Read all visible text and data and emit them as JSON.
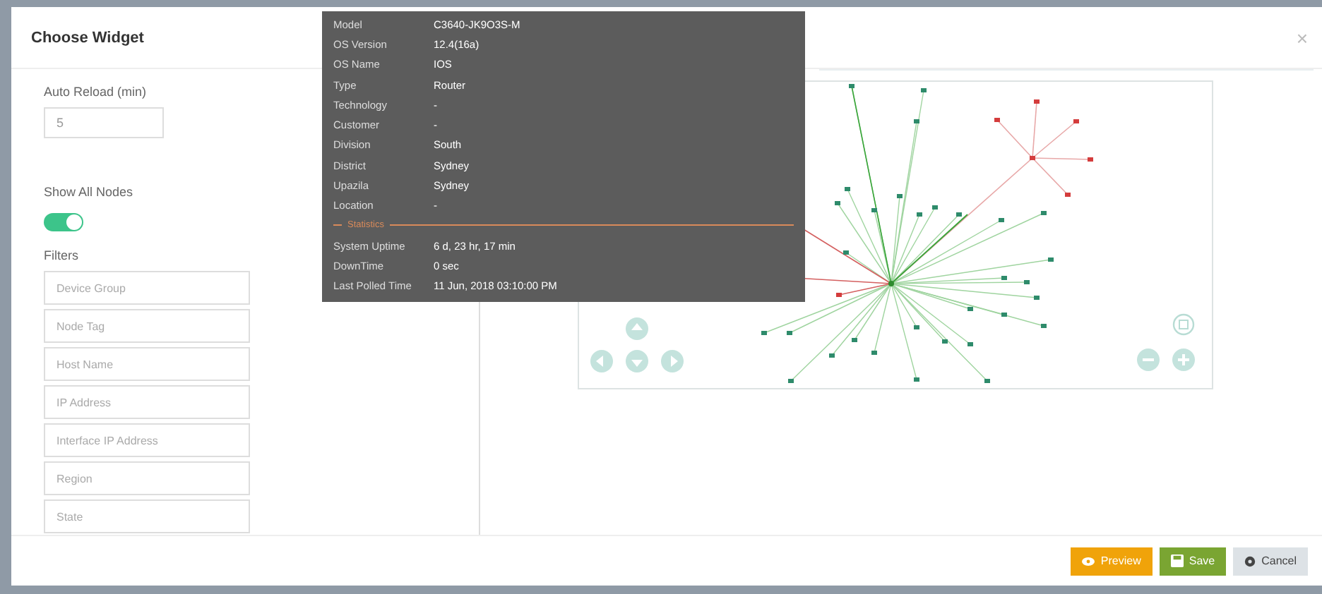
{
  "dialog": {
    "title": "Choose Widget",
    "close": "×"
  },
  "form": {
    "auto_reload": {
      "label": "Auto Reload (min)",
      "value": "5"
    },
    "show_all_nodes": {
      "label": "Show All Nodes",
      "on": true
    },
    "filters_label": "Filters",
    "filters": [
      {
        "placeholder": "Device Group"
      },
      {
        "placeholder": "Node Tag"
      },
      {
        "placeholder": "Host Name"
      },
      {
        "placeholder": "IP Address"
      },
      {
        "placeholder": "Interface IP Address"
      },
      {
        "placeholder": "Region"
      },
      {
        "placeholder": "State"
      }
    ]
  },
  "tooltip": {
    "rows": [
      {
        "label": "Model",
        "value": "C3640-JK9O3S-M"
      },
      {
        "label": "OS Version",
        "value": "12.4(16a)"
      },
      {
        "label": "OS Name",
        "value": "IOS"
      },
      {
        "label": "Type",
        "value": "Router"
      },
      {
        "label": "Technology",
        "value": "-"
      },
      {
        "label": "Customer",
        "value": "-"
      },
      {
        "label": "Division",
        "value": "South"
      },
      {
        "label": "District",
        "value": "Sydney"
      },
      {
        "label": "Upazila",
        "value": "Sydney"
      },
      {
        "label": "Location",
        "value": "-"
      }
    ],
    "section": "Statistics",
    "stats": [
      {
        "label": "System Uptime",
        "value": "6 d, 23 hr, 17 min"
      },
      {
        "label": "DownTime",
        "value": "0 sec"
      },
      {
        "label": "Last Polled Time",
        "value": "11 Jun, 2018  03:10:00 PM"
      }
    ]
  },
  "buttons": [
    {
      "kind": "preview",
      "label": "Preview"
    },
    {
      "kind": "save",
      "label": "Save"
    },
    {
      "kind": "cancel",
      "label": "Cancel"
    }
  ]
}
